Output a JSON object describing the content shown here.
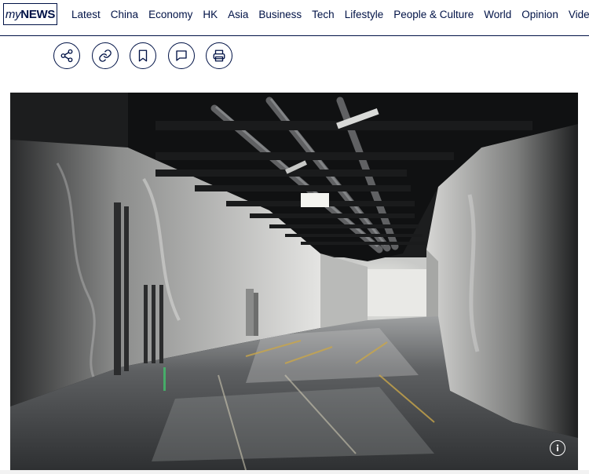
{
  "header": {
    "logo_my": "my",
    "logo_news": "NEWS",
    "nav": [
      "Latest",
      "China",
      "Economy",
      "HK",
      "Asia",
      "Business",
      "Tech",
      "Lifestyle",
      "People & Culture",
      "World",
      "Opinion",
      "Video"
    ]
  },
  "actions": [
    {
      "icon": "share-icon"
    },
    {
      "icon": "link-icon"
    },
    {
      "icon": "bookmark-icon"
    },
    {
      "icon": "comment-icon"
    },
    {
      "icon": "print-icon"
    }
  ],
  "hero": {
    "info_icon": "info-icon"
  },
  "colors": {
    "brand_navy": "#001246",
    "rock": "#d8d8d6",
    "floor": "#4c4e50"
  }
}
